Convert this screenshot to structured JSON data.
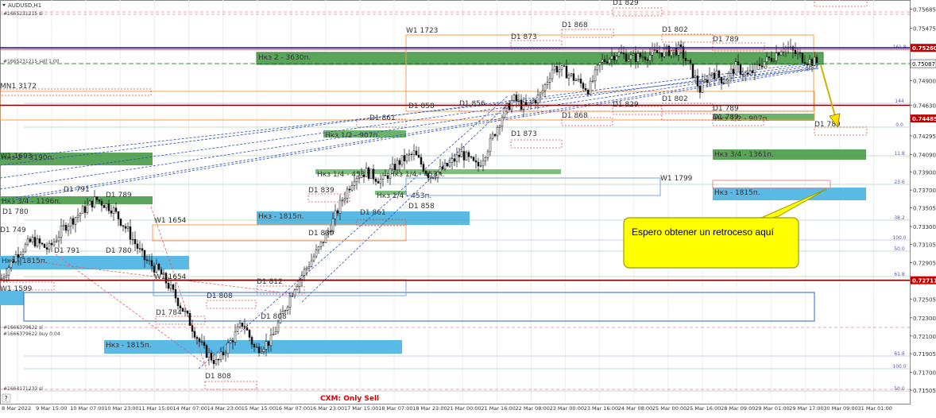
{
  "chart_data": {
    "type": "candlestick",
    "symbol_label": "AUDUSD,H1",
    "y_range": [
      0.71235,
      0.75785
    ],
    "price_ticks": [
      0.75685,
      0.75475,
      0.7526,
      0.75087,
      0.749,
      0.7463,
      0.74485,
      0.74295,
      0.7409,
      0.739,
      0.737,
      0.73505,
      0.733,
      0.73105,
      0.72905,
      0.72711,
      0.72505,
      0.723,
      0.721,
      0.71905,
      0.717,
      0.71505,
      0.71315
    ],
    "price_tick_labels": [
      "0.75685",
      "0.75475",
      "0.75260",
      "0.75087",
      "0.74900",
      "0.74630",
      "0.74485",
      "0.74295",
      "0.74090",
      "0.73900",
      "0.73700",
      "0.73505",
      "0.73300",
      "0.73105",
      "0.72905",
      "0.72711",
      "0.72505",
      "0.72300",
      "0.72100",
      "0.71905",
      "0.71700",
      "0.71505",
      "0.71315"
    ],
    "time_labels": [
      "8 Mar 2022",
      "9 Mar 15:00",
      "10 Mar 07:00",
      "10 Mar 23:00",
      "11 Mar 15:00",
      "14 Mar 07:00",
      "14 Mar 23:00",
      "15 Mar 15:00",
      "16 Mar 07:00",
      "16 Mar 23:00",
      "17 Mar 15:00",
      "18 Mar 07:00",
      "18 Mar 23:00",
      "21 Mar 00:00",
      "21 Mar 16:00",
      "22 Mar 08:00",
      "23 Mar 00:00",
      "23 Mar 16:00",
      "24 Mar 08:00",
      "25 Mar 00:00",
      "25 Mar 16:00",
      "28 Mar 09:00",
      "29 Mar 01:00",
      "29 Mar 17:00",
      "30 Mar 09:00",
      "31 Mar 01:00"
    ],
    "horizontal_lines": [
      {
        "price": 0.7526,
        "color": "#c00000",
        "label": "#1665231215 sell 1.00"
      },
      {
        "price": 0.7463,
        "color": "#7a0000",
        "label": ""
      },
      {
        "price": 0.72711,
        "color": "#7a0000",
        "label": ""
      },
      {
        "price": 0.75087,
        "color": "#2a7a2a",
        "label": ""
      }
    ],
    "order_labels": [
      "#1665231215 sl",
      "#1665231215 sell 1.00",
      "#1666379622 sl",
      "#1666379622 buy 0.04",
      "#1664171233 sl"
    ],
    "fib_levels": [
      "161.8",
      "144",
      "0.0",
      "11.8",
      "23.6",
      "38.2",
      "100.0",
      "50.0",
      "61.8",
      "61.8",
      "100.0",
      "50.0"
    ],
    "zones": [
      {
        "label": "Нкз 2 - 3630п.",
        "color": "#5aa55a"
      },
      {
        "label": "Нкз 1/2 - 907п.",
        "color": "#5aa55a"
      },
      {
        "label": "Нкз 2 - 3190п.",
        "color": "#5aa55a"
      },
      {
        "label": "Нкз 3/4 - 1196п.",
        "color": "#5aa55a"
      },
      {
        "label": "Нкз 1/4 - 453п.",
        "color": "#5aa55a"
      },
      {
        "label": "Нкз 1/4 - 453п.",
        "color": "#5aa55a"
      },
      {
        "label": "Нкз 1/4 - 453п.",
        "color": "#5aa55a"
      },
      {
        "label": "Нкз - 1815п.",
        "color": "#5bb9e6"
      },
      {
        "label": "Нкз 1/2 - 907п.",
        "color": "#5aa55a"
      },
      {
        "label": "Нкз 3/4 - 1361п.",
        "color": "#5aa55a"
      },
      {
        "label": "Нкз - 1815п.",
        "color": "#5bb9e6"
      },
      {
        "label": "Нкз - 1815п.",
        "color": "#5bb9e6"
      },
      {
        "label": "Нкз - 1815п.",
        "color": "#5bb9e6"
      }
    ],
    "level_labels": [
      "D1 829",
      "W1 1723",
      "D1 868",
      "D1 802",
      "D1 873",
      "D1 789",
      "MN1 3172",
      "D1 858",
      "D1 856",
      "D1 829",
      "D1 861",
      "D1 868",
      "D1 802",
      "D1 789",
      "D1 789",
      "D1 873",
      "W1 1693",
      "D1 839",
      "W1 1799",
      "D1 791",
      "D1 789",
      "D1 780",
      "D1 861",
      "D1 858",
      "W1 1654",
      "D1 749",
      "D1 839",
      "D1 791",
      "D1 780",
      "W1 1654",
      "D1 812",
      "D1 808",
      "W1 1599",
      "D1 784",
      "D1 808",
      "D1 808"
    ],
    "annotation": "Espero obtener un retroceso aquí",
    "footer_text": "CXM: Only Sell"
  }
}
